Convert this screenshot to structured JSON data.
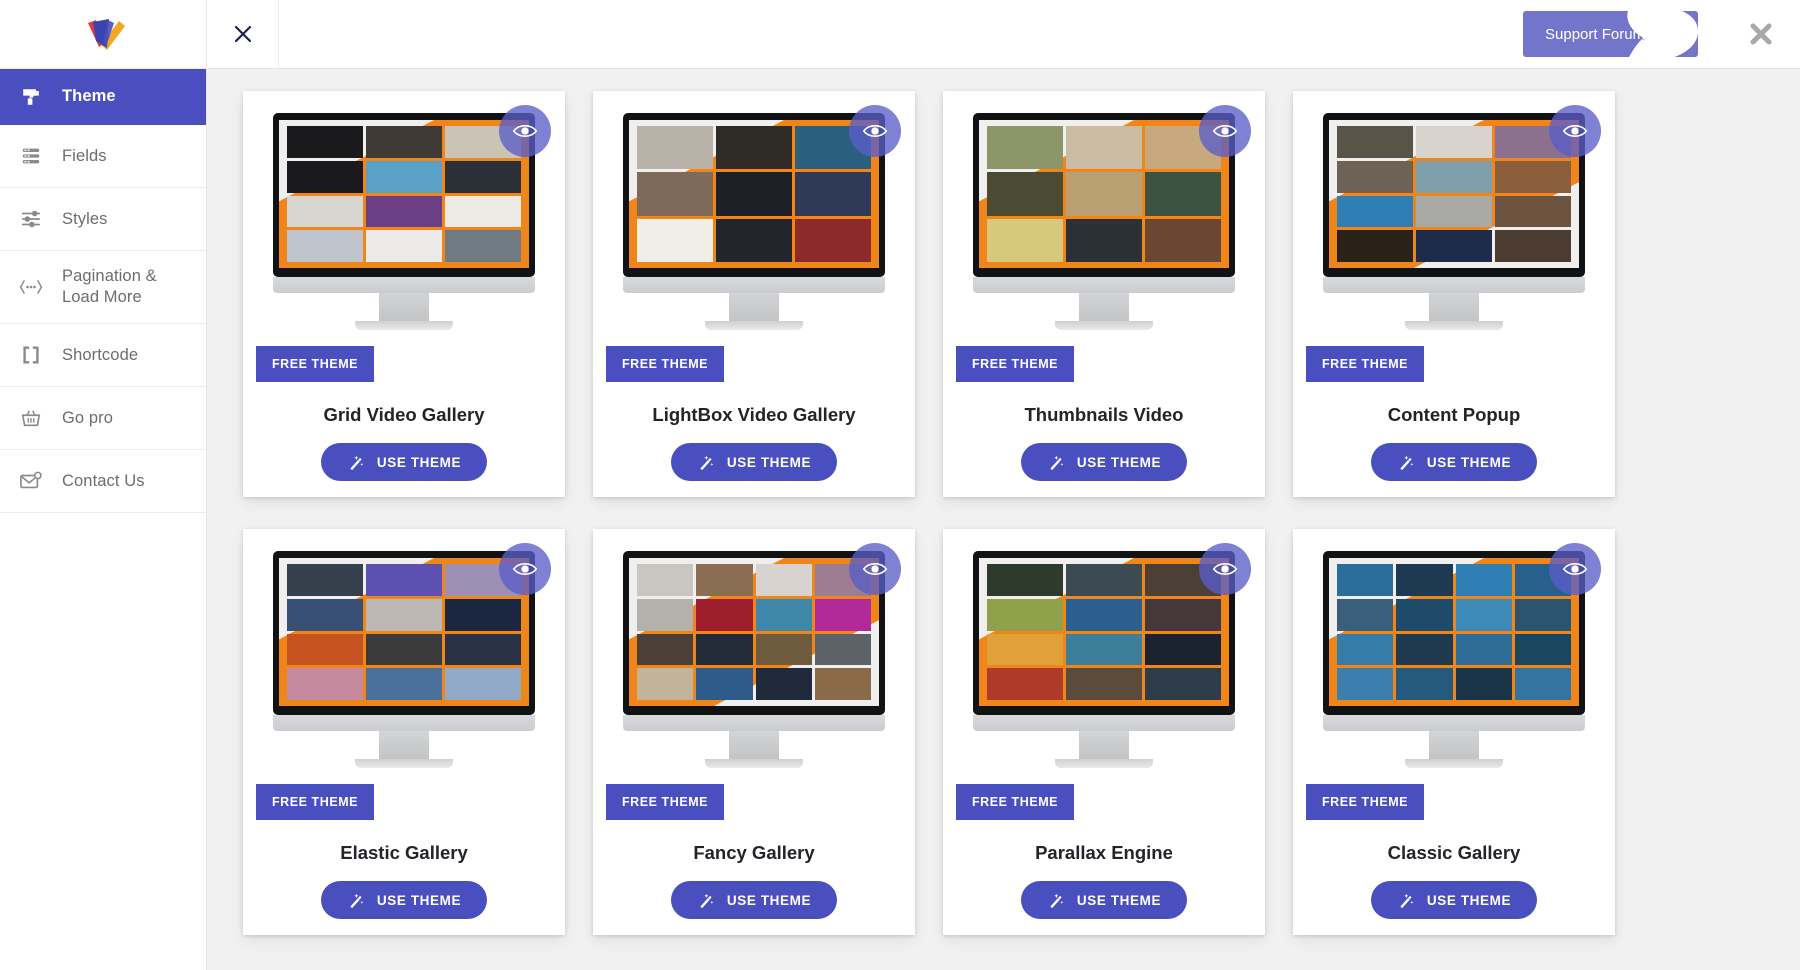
{
  "app": {
    "logo_name": "visualizer-logo",
    "accent": "#4a4fc0",
    "accent_light": "#7275c9",
    "bg": "#f1f1f1",
    "badge_orange": "#f08519"
  },
  "sidebar": {
    "items": [
      {
        "label": "Theme",
        "icon": "paint-roller-icon",
        "active": true
      },
      {
        "label": "Fields",
        "icon": "fields-list-icon",
        "active": false
      },
      {
        "label": "Styles",
        "icon": "sliders-icon",
        "active": false
      },
      {
        "label": "Pagination &\nLoad More",
        "icon": "pagination-dots-icon",
        "active": false
      },
      {
        "label": "Shortcode",
        "icon": "brackets-icon",
        "active": false
      },
      {
        "label": "Go pro",
        "icon": "basket-icon",
        "active": false
      },
      {
        "label": "Contact Us",
        "icon": "envelope-icon",
        "active": false
      }
    ]
  },
  "topbar": {
    "close_left_icon": "close-icon",
    "support_label": "Support Forum",
    "support_icon": "chat-bubble-icon",
    "close_right_icon": "close-icon"
  },
  "labels": {
    "free_badge": "FREE THEME",
    "use_theme": "USE THEME",
    "use_theme_icon": "magic-wand-icon",
    "preview_icon": "eye-icon"
  },
  "themes": [
    {
      "title": "Grid Video Gallery",
      "badge": "FREE THEME",
      "button": "USE THEME",
      "layout": "g3x4"
    },
    {
      "title": "LightBox Video Gallery",
      "badge": "FREE THEME",
      "button": "USE THEME",
      "layout": "g3"
    },
    {
      "title": "Thumbnails Video",
      "badge": "FREE THEME",
      "button": "USE THEME",
      "layout": "g3"
    },
    {
      "title": "Content Popup",
      "badge": "FREE THEME",
      "button": "USE THEME",
      "layout": "g3x4"
    },
    {
      "title": "Elastic Gallery",
      "badge": "FREE THEME",
      "button": "USE THEME",
      "layout": "g3x4"
    },
    {
      "title": "Fancy Gallery",
      "badge": "FREE THEME",
      "button": "USE THEME",
      "layout": "g4"
    },
    {
      "title": "Parallax Engine",
      "badge": "FREE THEME",
      "button": "USE THEME",
      "layout": "g3x4"
    },
    {
      "title": "Classic Gallery",
      "badge": "FREE THEME",
      "button": "USE THEME",
      "layout": "g4"
    }
  ]
}
